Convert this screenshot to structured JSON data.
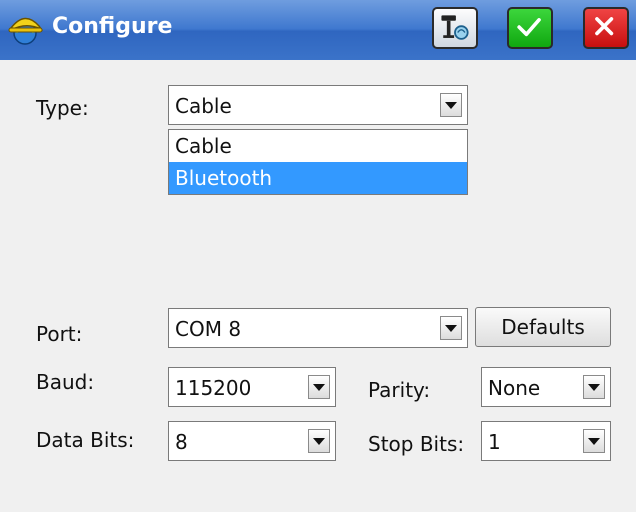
{
  "window": {
    "title": "Configure",
    "icons": {
      "app": "hardhat-globe-icon",
      "instrument": "gps-receiver-icon",
      "ok": "checkmark-icon",
      "cancel": "close-icon"
    },
    "colors": {
      "titlebar": "#3f78cf",
      "ok": "#22b522",
      "cancel": "#de2a2a",
      "selection": "#3399ff"
    }
  },
  "form": {
    "type_label": "Type:",
    "type_value": "Cable",
    "type_options": [
      "Cable",
      "Bluetooth"
    ],
    "type_highlighted": "Bluetooth",
    "port_label": "Port:",
    "port_value": "COM 8",
    "defaults_label": "Defaults",
    "baud_label": "Baud:",
    "baud_value": "115200",
    "parity_label": "Parity:",
    "parity_value": "None",
    "databits_label": "Data Bits:",
    "databits_value": "8",
    "stopbits_label": "Stop Bits:",
    "stopbits_value": "1"
  }
}
